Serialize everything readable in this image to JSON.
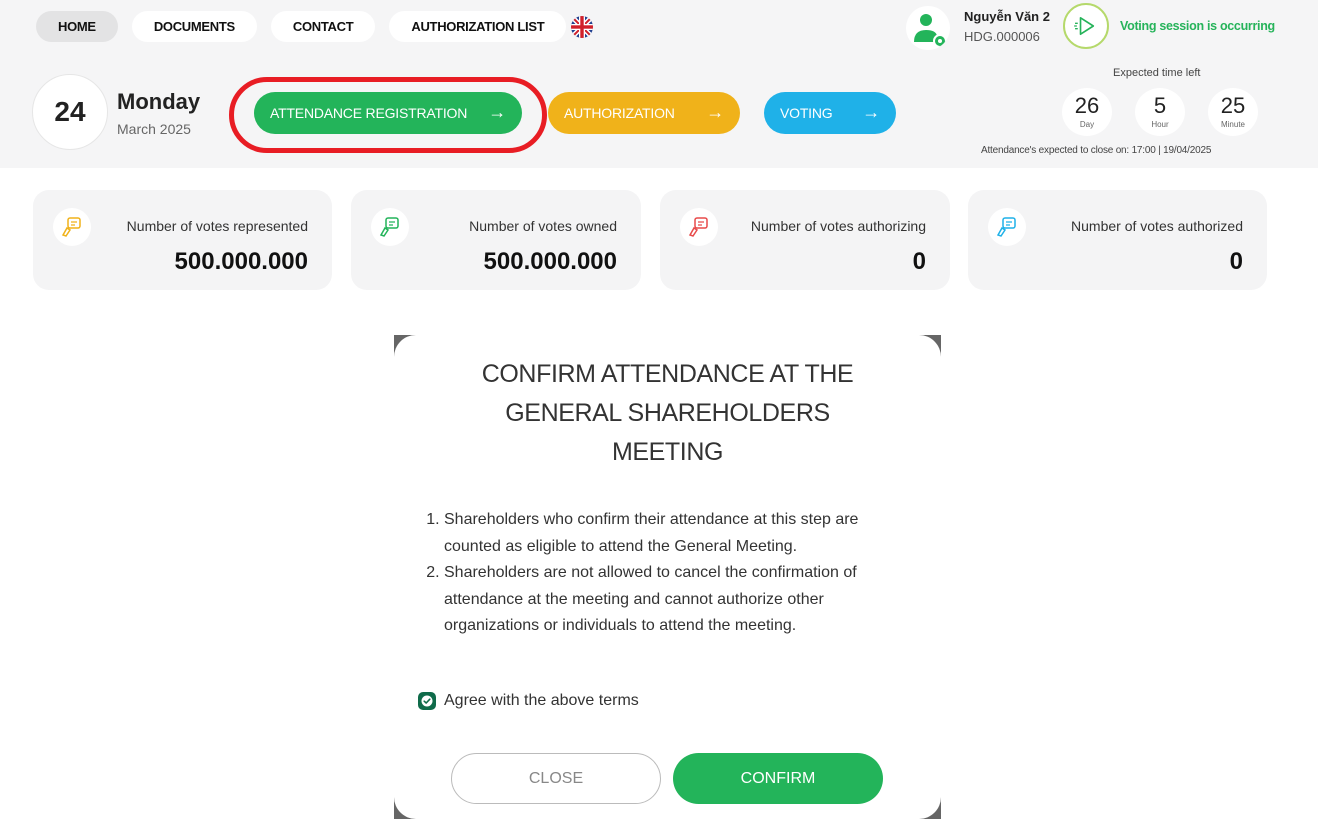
{
  "nav": {
    "items": [
      "HOME",
      "DOCUMENTS",
      "CONTACT",
      "AUTHORIZATION LIST"
    ],
    "language_icon": "uk-flag-icon"
  },
  "user": {
    "name": "Nguyễn Văn 2",
    "code": "HDG.000006",
    "icon": "user-settings-icon"
  },
  "voting": {
    "status": "Voting session is occurring",
    "icon": "play-circle-icon"
  },
  "date": {
    "day": "24",
    "weekday": "Monday",
    "month_year": "March 2025"
  },
  "actions": {
    "attendance": "ATTENDANCE REGISTRATION",
    "authorization": "AUTHORIZATION",
    "voting": "VOTING",
    "arrow": "→"
  },
  "countdown": {
    "label": "Expected time left",
    "days": "26",
    "days_unit": "Day",
    "hours": "5",
    "hours_unit": "Hour",
    "minutes": "25",
    "minutes_unit": "Minute",
    "close_note": "Attendance's expected to close on: 17:00 | 19/04/2025"
  },
  "stats": [
    {
      "label": "Number of votes represented",
      "value": "500.000.000",
      "color": "#f0b21a"
    },
    {
      "label": "Number of votes owned",
      "value": "500.000.000",
      "color": "#23b45a"
    },
    {
      "label": "Number of votes authorizing",
      "value": "0",
      "color": "#e84a4a"
    },
    {
      "label": "Number of votes authorized",
      "value": "0",
      "color": "#1fb1e8"
    }
  ],
  "modal": {
    "title": "CONFIRM ATTENDANCE AT THE GENERAL SHAREHOLDERS MEETING",
    "terms": [
      "Shareholders who confirm their attendance at this step are counted as eligible to attend the General Meeting.",
      "Shareholders are not allowed to cancel the confirmation of attendance at the meeting and cannot authorize other organizations or individuals to attend the meeting."
    ],
    "agree_label": "Agree with the above terms",
    "agree_checked": true,
    "close_label": "CLOSE",
    "confirm_label": "CONFIRM"
  },
  "colors": {
    "green": "#23b45a",
    "yellow": "#f0b21a",
    "blue": "#1fb1e8",
    "highlight_red": "#e81d24"
  }
}
